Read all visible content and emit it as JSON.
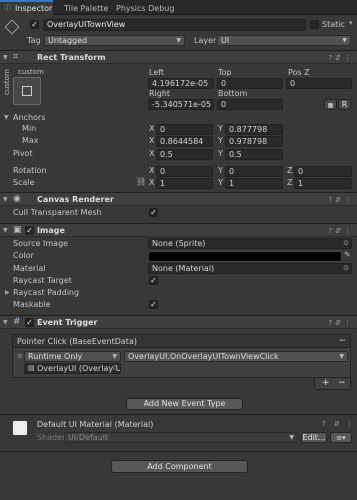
{
  "tabs": [
    "Inspector",
    "Tile Palette",
    "Physics Debug"
  ],
  "object": {
    "name": "OverlayUITownView",
    "static_label": "Static",
    "tag_label": "Tag",
    "tag_value": "Untagged",
    "layer_label": "Layer",
    "layer_value": "UI"
  },
  "rect_transform": {
    "title": "Rect Transform",
    "anchor_preset": "custom",
    "side_label": "custom",
    "left_label": "Left",
    "left": "4.196172e-05",
    "top_label": "Top",
    "top": "0",
    "posz_label": "Pos Z",
    "posz": "0",
    "right_label": "Right",
    "right": "-5.340571e-05",
    "bottom_label": "Bottom",
    "bottom": "0",
    "r_button": "R",
    "anchors_label": "Anchors",
    "min_label": "Min",
    "min_x": "0",
    "min_y": "0.877798",
    "max_label": "Max",
    "max_x": "0.8644584",
    "max_y": "0.978798",
    "pivot_label": "Pivot",
    "pivot_x": "0.5",
    "pivot_y": "0.5",
    "rotation_label": "Rotation",
    "rot_x": "0",
    "rot_y": "0",
    "rot_z": "0",
    "scale_label": "Scale",
    "scale_x": "1",
    "scale_y": "1",
    "scale_z": "1",
    "x": "X",
    "y": "Y",
    "z": "Z"
  },
  "canvas_renderer": {
    "title": "Canvas Renderer",
    "cull_label": "Cull Transparent Mesh"
  },
  "image": {
    "title": "Image",
    "source_label": "Source Image",
    "source_value": "None (Sprite)",
    "color_label": "Color",
    "material_label": "Material",
    "material_value": "None (Material)",
    "raycast_label": "Raycast Target",
    "padding_label": "Raycast Padding",
    "maskable_label": "Maskable"
  },
  "event_trigger": {
    "title": "Event Trigger",
    "event_label": "Pointer Click (BaseEventData)",
    "runtime": "Runtime Only",
    "function": "OverlayUI.OnOverlayUITownViewClick",
    "object_ref": "OverlayUI (Overlay UI)",
    "plus": "+",
    "minus": "−",
    "add_new": "Add New Event Type"
  },
  "material": {
    "title": "Default UI Material (Material)",
    "shader_label": "Shader",
    "shader_value": "UI/Default",
    "edit": "Edit..."
  },
  "add_component": "Add Component",
  "colors": {
    "panel": "#383838",
    "field": "#2a2a2a",
    "header": "#3e3e3e",
    "color_swatch": "#000000"
  }
}
